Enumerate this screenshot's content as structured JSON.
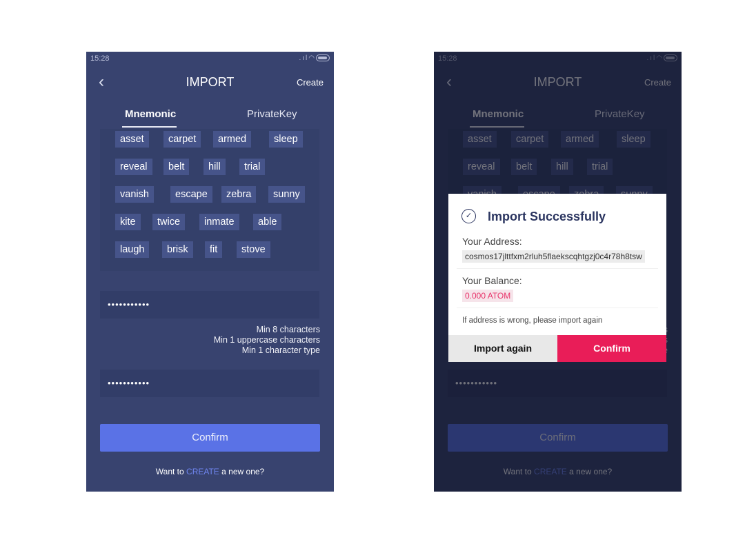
{
  "status_bar": {
    "time": "15:28"
  },
  "header": {
    "title": "IMPORT",
    "create_label": "Create",
    "back_icon": "chevron-left-icon"
  },
  "tabs": [
    {
      "label": "Mnemonic",
      "active": true
    },
    {
      "label": "PrivateKey",
      "active": false
    }
  ],
  "mnemonic_rows": [
    [
      "asset",
      "carpet",
      "armed",
      "sleep"
    ],
    [
      "reveal",
      "belt",
      "hill",
      "trial"
    ],
    [
      "vanish",
      "escape",
      "zebra",
      "sunny"
    ],
    [
      "kite",
      "twice",
      "inmate",
      "able"
    ],
    [
      "laugh",
      "brisk",
      "fit",
      "stove"
    ]
  ],
  "password": {
    "value": "•••••••••••"
  },
  "password_hints": [
    "Min 8 characters",
    "Min 1 uppercase characters",
    "Min 1 character type"
  ],
  "confirm_password": {
    "value": "•••••••••••"
  },
  "confirm_label": "Confirm",
  "footer": {
    "prefix": "Want to ",
    "link": "CREATE",
    "suffix": " a new one?"
  },
  "modal": {
    "title": "Import Successfully",
    "address_label": "Your Address:",
    "address": "cosmos17jlttfxm2rluh5flaekscqhtgzj0c4r78h8tsw",
    "balance_label": "Your Balance:",
    "balance": "0.000 ATOM",
    "note": "If address is wrong, please import again",
    "import_again_label": "Import again",
    "confirm_label": "Confirm"
  },
  "colors": {
    "background": "#38436f",
    "button": "#5a72e6",
    "accent": "#e91d58",
    "link": "#6f86f0"
  }
}
